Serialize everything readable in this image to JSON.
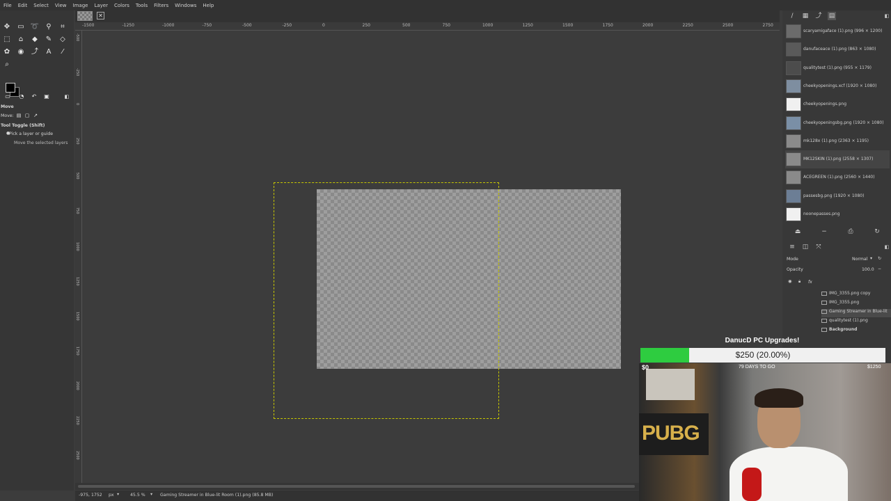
{
  "menu": [
    "File",
    "Edit",
    "Select",
    "View",
    "Image",
    "Layer",
    "Colors",
    "Tools",
    "Filters",
    "Windows",
    "Help"
  ],
  "ruler": {
    "h_ticks": [
      "-1500",
      "-1250",
      "-1000",
      "-750",
      "-500",
      "-250",
      "0",
      "250",
      "500",
      "750",
      "1000",
      "1250",
      "1500",
      "1750",
      "2000",
      "2250",
      "2500",
      "2750"
    ],
    "v_ticks": [
      "-500",
      "-250",
      "0",
      "250",
      "500",
      "750",
      "1000",
      "1250",
      "1500",
      "1750",
      "2000",
      "2250",
      "2500"
    ]
  },
  "tool_options": {
    "title": "Move",
    "move_label": "Move:",
    "toggle_label": "Tool Toggle  (Shift)",
    "option1": "Pick a layer or guide",
    "option2": "Move the selected layers"
  },
  "images_panel": [
    {
      "label": "scaryamigaface (1).png (996 × 1200)",
      "thumb": "#6b6b6b"
    },
    {
      "label": "danufaceace (1).png (863 × 1080)",
      "thumb": "#5a5a5a"
    },
    {
      "label": "qualitytest (1).png (955 × 1179)",
      "thumb": "#4c4c4c"
    },
    {
      "label": "cheekyopenings.xcf (1920 × 1080)",
      "thumb": "#7e8ea0"
    },
    {
      "label": "cheekyopenings.png",
      "thumb": "#f0f0f0"
    },
    {
      "label": "cheekyopeningsbg.png (1920 × 1080)",
      "thumb": "#7a8fa6"
    },
    {
      "label": "mk128x (1).png (2363 × 1195)",
      "thumb": "#8a8a8a"
    },
    {
      "label": "MK12SKIN (1).png (2558 × 1307)",
      "thumb": "#8a8a8a"
    },
    {
      "label": "ACEGREEN (1).png (2560 × 1440)",
      "thumb": "#8a8a8a"
    },
    {
      "label": "passesbg.png (1920 × 1080)",
      "thumb": "#6c7e95"
    },
    {
      "label": "noonepasses.png",
      "thumb": "#f0f0f0"
    }
  ],
  "layers_panel": {
    "mode_label": "Mode",
    "mode_value": "Normal",
    "opacity_label": "Opacity",
    "opacity_value": "100.0",
    "fx": "fx",
    "layers": [
      "IMG_3355.png copy",
      "IMG_3355.png",
      "Gaming Streamer in Blue-lit",
      "qualitytest (1).png",
      "Background"
    ]
  },
  "status": {
    "coords": "-975, 1752",
    "unit": "px",
    "zoom": "45.5 %",
    "message": "Gaming Streamer in Blue-lit Room (1).png (85.8 MB)"
  },
  "overlay": {
    "title": "DanucD PC Upgrades!",
    "amount": "$250 (20.00%)",
    "progress": 0.2,
    "start": "$0",
    "end": "$1250",
    "days": "79 DAYS TO GO",
    "sign": "PUBG"
  },
  "colors": {
    "progress_fill": "#2ecc40",
    "selection_boundary": "#c8c800",
    "mic": "#c41818"
  }
}
